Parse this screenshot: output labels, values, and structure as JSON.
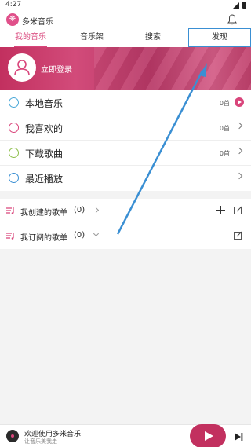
{
  "status_bar": {
    "time": "4:27"
  },
  "header": {
    "app_title": "多米音乐",
    "logo_glyph": "❋"
  },
  "tabs": [
    {
      "label": "我的音乐"
    },
    {
      "label": "音乐架"
    },
    {
      "label": "搜索"
    },
    {
      "label": "发现"
    }
  ],
  "login": {
    "text": "立即登录"
  },
  "menu": [
    {
      "label": "本地音乐",
      "count": "0首",
      "icon": "music-note-icon",
      "color": "#4aa8d8"
    },
    {
      "label": "我喜欢的",
      "count": "0首",
      "icon": "heart-icon",
      "color": "#d9457b"
    },
    {
      "label": "下载歌曲",
      "count": "0首",
      "icon": "download-icon",
      "color": "#8dbf4a"
    },
    {
      "label": "最近播放",
      "count": "",
      "icon": "clock-icon",
      "color": "#3a8fd3"
    }
  ],
  "playlists": [
    {
      "label": "我创建的歌单",
      "count": "(0)"
    },
    {
      "label": "我订阅的歌单",
      "count": "(0)"
    }
  ],
  "player": {
    "title": "欢迎使用多米音乐",
    "subtitle": "让音乐美我走"
  },
  "colors": {
    "accent": "#d9457b",
    "banner": "#c2305f",
    "annotation": "#3a8fd3"
  }
}
